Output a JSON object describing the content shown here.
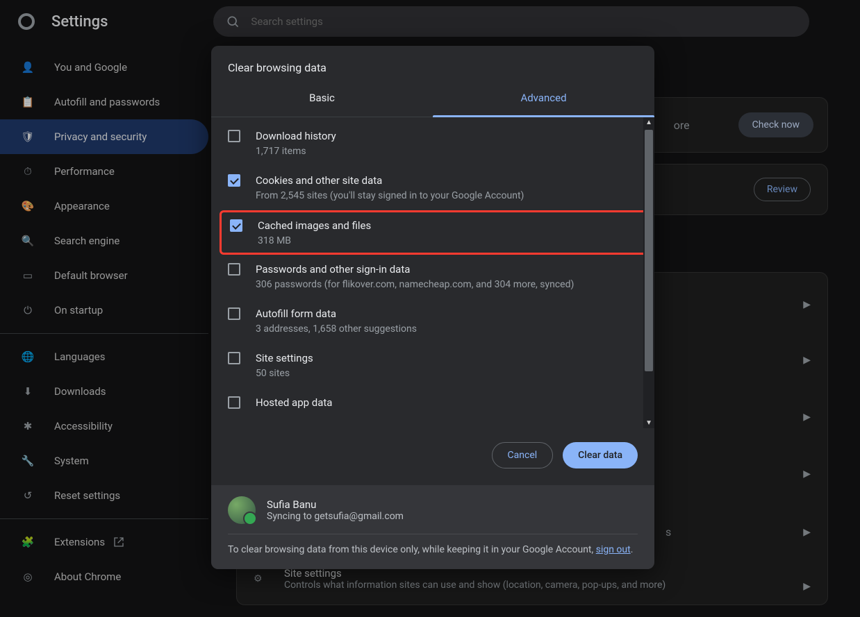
{
  "header": {
    "title": "Settings",
    "search_placeholder": "Search settings"
  },
  "sidebar": {
    "items": [
      {
        "icon": "person",
        "label": "You and Google"
      },
      {
        "icon": "clipboard",
        "label": "Autofill and passwords"
      },
      {
        "icon": "shield",
        "label": "Privacy and security",
        "active": true
      },
      {
        "icon": "gauge",
        "label": "Performance"
      },
      {
        "icon": "palette",
        "label": "Appearance"
      },
      {
        "icon": "search",
        "label": "Search engine"
      },
      {
        "icon": "window",
        "label": "Default browser"
      },
      {
        "icon": "power",
        "label": "On startup"
      }
    ],
    "items2": [
      {
        "icon": "globe",
        "label": "Languages"
      },
      {
        "icon": "download",
        "label": "Downloads"
      },
      {
        "icon": "accessibility",
        "label": "Accessibility"
      },
      {
        "icon": "wrench",
        "label": "System"
      },
      {
        "icon": "restore",
        "label": "Reset settings"
      }
    ],
    "items3": [
      {
        "icon": "puzzle",
        "label": "Extensions",
        "external": true
      },
      {
        "icon": "chrome",
        "label": "About Chrome"
      }
    ]
  },
  "bg": {
    "check_now": "Check now",
    "review": "Review",
    "more_text": "ore",
    "site_settings_title": "Site settings",
    "site_settings_desc": "Controls what information sites can use and show (location, camera, pop-ups, and more)",
    "obscured_s": "s"
  },
  "modal": {
    "title": "Clear browsing data",
    "tabs": {
      "basic": "Basic",
      "advanced": "Advanced"
    },
    "options": [
      {
        "checked": false,
        "title": "Download history",
        "sub": "1,717 items"
      },
      {
        "checked": true,
        "title": "Cookies and other site data",
        "sub": "From 2,545 sites (you'll stay signed in to your Google Account)"
      },
      {
        "checked": true,
        "highlight": true,
        "title": "Cached images and files",
        "sub": "318 MB"
      },
      {
        "checked": false,
        "title": "Passwords and other sign-in data",
        "sub": "306 passwords (for flikover.com, namecheap.com, and 304 more, synced)"
      },
      {
        "checked": false,
        "title": "Autofill form data",
        "sub": "3 addresses, 1,658 other suggestions"
      },
      {
        "checked": false,
        "title": "Site settings",
        "sub": "50 sites"
      },
      {
        "checked": false,
        "title": "Hosted app data",
        "sub": ""
      }
    ],
    "actions": {
      "cancel": "Cancel",
      "clear": "Clear data"
    },
    "user": {
      "name": "Sufia Banu",
      "sync": "Syncing to getsufia@gmail.com"
    },
    "footer_text_a": "To clear browsing data from this device only, while keeping it in your Google Account, ",
    "footer_signout": "sign out",
    "footer_text_b": "."
  }
}
